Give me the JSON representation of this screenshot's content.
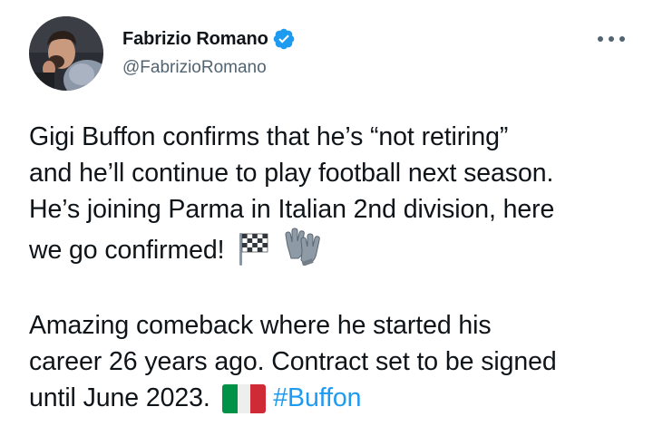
{
  "author": {
    "display_name": "Fabrizio Romano",
    "handle": "@FabrizioRomano",
    "verified_icon": "verified-badge-icon",
    "avatar_icon": "profile-photo"
  },
  "menu": {
    "icon": "more-horizontal-icon"
  },
  "tweet": {
    "p1_line1": "Gigi Buffon confirms that he’s “not retiring”",
    "p1_line2": "and he’ll continue to play football next season.",
    "p1_line3": "He’s joining Parma in Italian 2nd division, here",
    "p1_line4": "we go confirmed!",
    "p1_emojis": [
      "chequered-flag-icon",
      "gloves-icon"
    ],
    "p2_line1": "Amazing comeback where he started his",
    "p2_line2": "career 26 years ago. Contract set to be signed",
    "p2_line3": "until June 2023.",
    "p2_emoji": "italy-flag-icon",
    "hashtag": "#Buffon"
  },
  "colors": {
    "text": "#0f1419",
    "secondary": "#536471",
    "link": "#1d9bf0",
    "verified": "#1d9bf0"
  }
}
